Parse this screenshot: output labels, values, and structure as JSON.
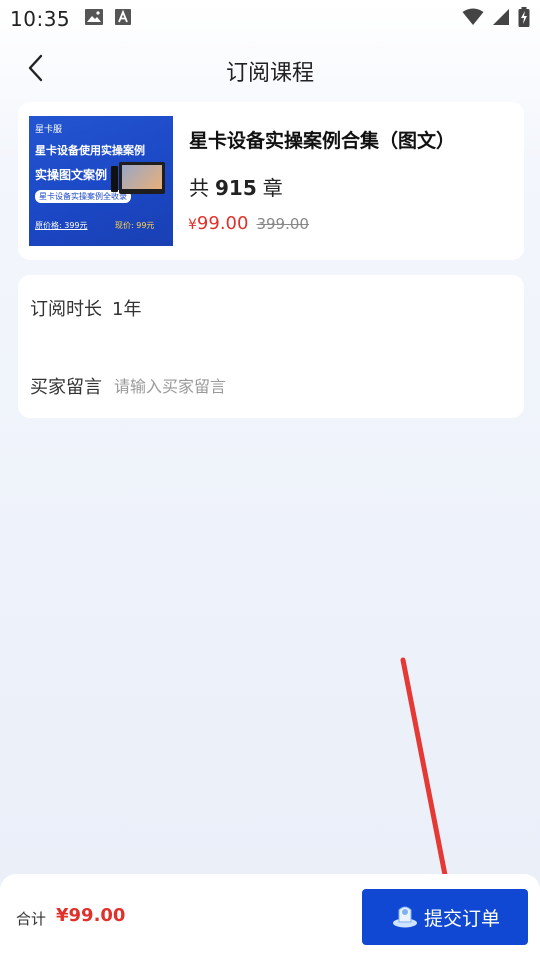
{
  "status_bar": {
    "time": "10:35",
    "icons_left": [
      "image-icon",
      "font-a-icon"
    ],
    "icons_right": [
      "wifi-icon",
      "signal-icon",
      "battery-charging-icon"
    ]
  },
  "header": {
    "title": "订阅课程",
    "back_icon": "chevron-left-icon"
  },
  "course": {
    "cover": {
      "brand": "星卡服",
      "headline": "星卡设备使用实操案例",
      "subhead": "实操图文案例",
      "tagline": "星卡设备实操案例全收录",
      "footer_left": "原价格: 399元",
      "footer_right": "现价: 99元"
    },
    "title": "星卡设备实操案例合集（图文）",
    "chapter_prefix": "共",
    "chapter_count": "915",
    "chapter_suffix": "章",
    "price_symbol": "¥",
    "price_current": "99.00",
    "price_original": "399.00"
  },
  "subscription": {
    "duration_label": "订阅时长",
    "duration_value": "1年",
    "message_label": "买家留言",
    "message_value": "",
    "message_placeholder": "请输入买家留言"
  },
  "footer": {
    "total_label": "合计",
    "total_amount": "¥99.00",
    "submit_label": "提交订单"
  },
  "colors": {
    "accent_blue": "#1048d3",
    "price_red": "#e0322d",
    "annotation_arrow": "#e53935"
  }
}
